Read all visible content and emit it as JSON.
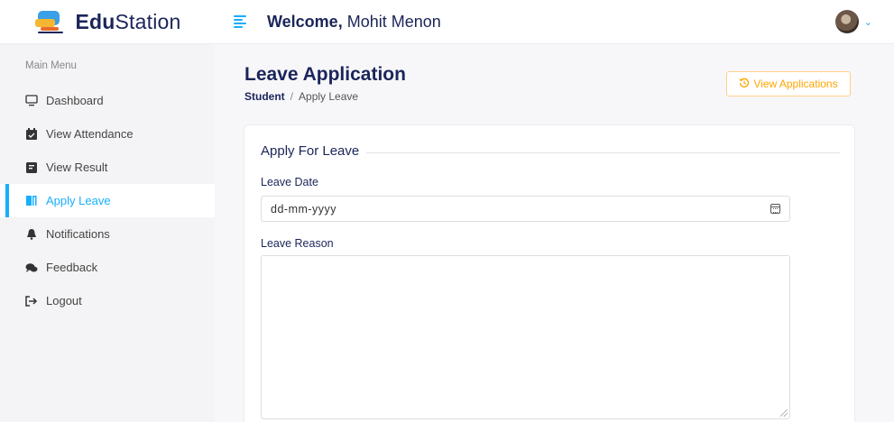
{
  "brand": {
    "name_bold": "Edu",
    "name_rest": "Station"
  },
  "header": {
    "welcome_bold": "Welcome,",
    "user_name": "Mohit Menon"
  },
  "sidebar": {
    "menu_title": "Main Menu",
    "items": [
      {
        "label": "Dashboard",
        "icon": "monitor-icon"
      },
      {
        "label": "View Attendance",
        "icon": "calendar-check-icon"
      },
      {
        "label": "View Result",
        "icon": "file-icon"
      },
      {
        "label": "Apply Leave",
        "icon": "door-icon",
        "active": true
      },
      {
        "label": "Notifications",
        "icon": "bell-icon"
      },
      {
        "label": "Feedback",
        "icon": "comments-icon"
      },
      {
        "label": "Logout",
        "icon": "sign-out-icon"
      }
    ]
  },
  "page": {
    "title": "Leave Application",
    "breadcrumb": {
      "parent": "Student",
      "separator": "/",
      "current": "Apply Leave"
    },
    "view_button": "View Applications"
  },
  "form": {
    "legend": "Apply For Leave",
    "date_label": "Leave Date",
    "date_placeholder": "dd-mm-yyyy",
    "reason_label": "Leave Reason"
  },
  "colors": {
    "accent": "#18aefa",
    "warning": "#ffa500",
    "heading": "#1b2559"
  }
}
